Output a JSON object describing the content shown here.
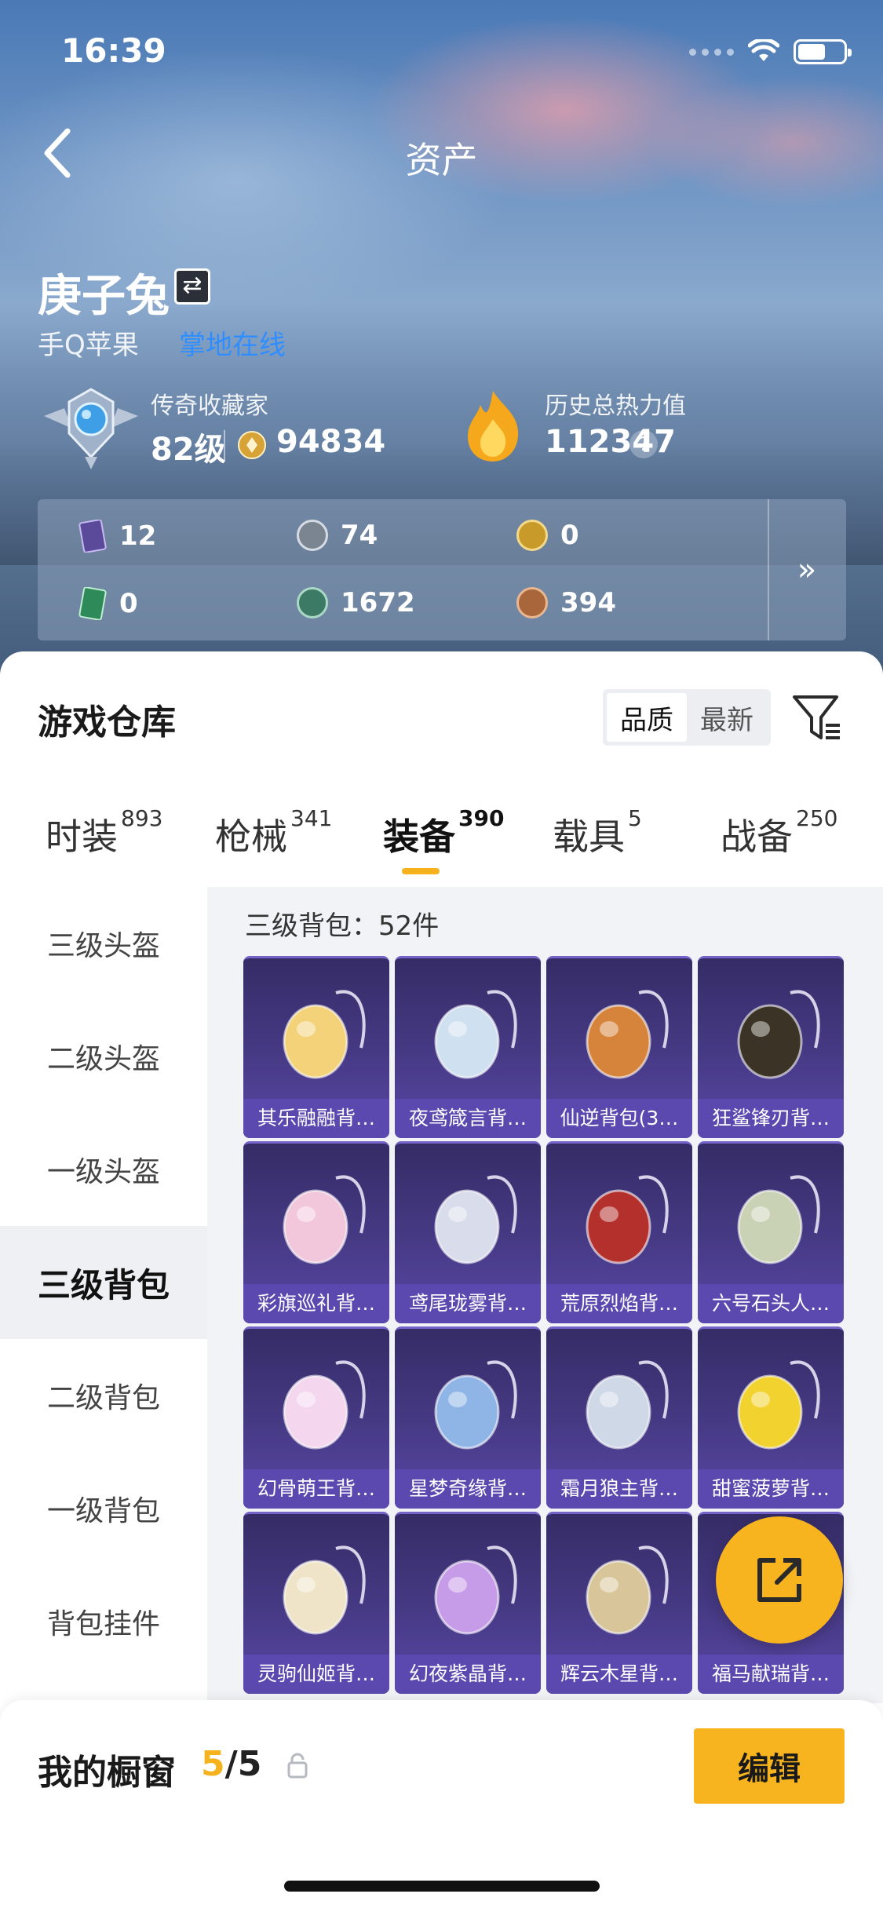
{
  "status_bar": {
    "time": "16:39"
  },
  "nav": {
    "title": "资产"
  },
  "profile": {
    "name": "庚子兔",
    "platform": "手Q苹果",
    "online_status": "掌地在线",
    "rank_title": "传奇收藏家",
    "level": "82级",
    "coins": "94834",
    "heat_title": "历史总热力值",
    "heat_value": "112347",
    "help_glyph": "?"
  },
  "currencies": [
    {
      "icon": "purple-card-icon",
      "value": "12",
      "color": "#5b4a9a"
    },
    {
      "icon": "silver-coin-icon",
      "value": "74",
      "color": "#7b8592"
    },
    {
      "icon": "gold-coin-icon",
      "value": "0",
      "color": "#c79a2a"
    },
    {
      "icon": "green-card-icon",
      "value": "0",
      "color": "#2f8a5a"
    },
    {
      "icon": "jade-coin-icon",
      "value": "1672",
      "color": "#3c7a66"
    },
    {
      "icon": "bronze-coin-icon",
      "value": "394",
      "color": "#a8663a"
    }
  ],
  "more_glyph": "»",
  "warehouse": {
    "title": "游戏仓库",
    "sort_options": [
      "品质",
      "最新"
    ],
    "sort_active": "品质"
  },
  "tabs": [
    {
      "label": "时装",
      "count": "893"
    },
    {
      "label": "枪械",
      "count": "341"
    },
    {
      "label": "装备",
      "count": "390"
    },
    {
      "label": "载具",
      "count": "5"
    },
    {
      "label": "战备",
      "count": "250"
    }
  ],
  "active_tab": "装备",
  "sidebar": [
    {
      "label": "三级头盔"
    },
    {
      "label": "二级头盔"
    },
    {
      "label": "一级头盔"
    },
    {
      "label": "三级背包"
    },
    {
      "label": "二级背包"
    },
    {
      "label": "一级背包"
    },
    {
      "label": "背包挂件"
    }
  ],
  "sidebar_active": "三级背包",
  "section_label": "三级背包：52件",
  "items": [
    {
      "name": "其乐融融背…",
      "color": "#f3d27a"
    },
    {
      "name": "夜鸢箴言背…",
      "color": "#cfe0f0"
    },
    {
      "name": "仙逆背包(3…",
      "color": "#d6843c"
    },
    {
      "name": "狂鲨锋刃背…",
      "color": "#3a3326"
    },
    {
      "name": "彩旗巡礼背…",
      "color": "#f2c7dc"
    },
    {
      "name": "鸢尾珑雾背…",
      "color": "#d9dcea"
    },
    {
      "name": "荒原烈焰背…",
      "color": "#b3302c"
    },
    {
      "name": "六号石头人…",
      "color": "#c9d2b4"
    },
    {
      "name": "幻骨萌王背…",
      "color": "#f4d7ee"
    },
    {
      "name": "星梦奇缘背…",
      "color": "#8fb4e6"
    },
    {
      "name": "霜月狼主背…",
      "color": "#cfd8e6"
    },
    {
      "name": "甜蜜菠萝背…",
      "color": "#f2d22e"
    },
    {
      "name": "灵驹仙姬背…",
      "color": "#efe4c8"
    },
    {
      "name": "幻夜紫晶背…",
      "color": "#c69be8"
    },
    {
      "name": "辉云木星背…",
      "color": "#d8c69a"
    },
    {
      "name": "福马献瑞背…",
      "color": "#e07a3a"
    }
  ],
  "showcase": {
    "label": "我的橱窗",
    "current": "5",
    "total": "/5"
  },
  "edit_label": "编辑",
  "colors": {
    "accent": "#f7b41e",
    "online": "#2f8eff",
    "item_bg": "#473a86"
  }
}
